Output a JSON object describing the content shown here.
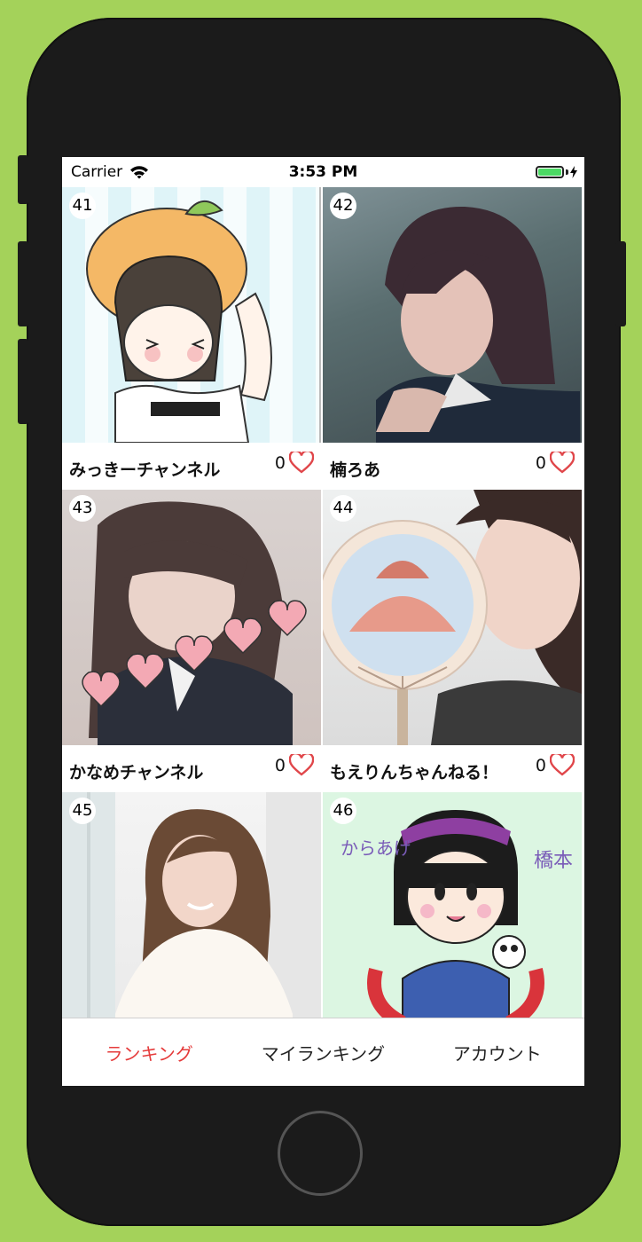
{
  "status_bar": {
    "carrier": "Carrier",
    "time": "3:53 PM"
  },
  "cells": [
    {
      "rank": "41",
      "name": "みっきーチャンネル",
      "likes": "0"
    },
    {
      "rank": "42",
      "name": "楠ろあ",
      "likes": "0"
    },
    {
      "rank": "43",
      "name": "かなめチャンネル",
      "likes": "0"
    },
    {
      "rank": "44",
      "name": "もえりんちゃんねる！",
      "likes": "0"
    },
    {
      "rank": "45",
      "name": "",
      "likes": ""
    },
    {
      "rank": "46",
      "name": "",
      "likes": ""
    }
  ],
  "tabs": [
    {
      "label": "ランキング",
      "active": true
    },
    {
      "label": "マイランキング",
      "active": false
    },
    {
      "label": "アカウント",
      "active": false
    }
  ],
  "colors": {
    "accent": "#e53b3b",
    "heart": "#e0464a",
    "background": "#a4d25a"
  }
}
